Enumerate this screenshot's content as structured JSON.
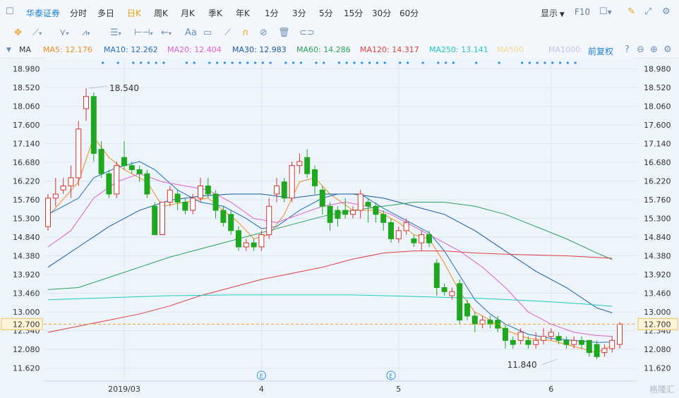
{
  "toolbar": {
    "brand": "华泰证券",
    "periods": [
      "分时",
      "多日",
      "日K",
      "周K",
      "月K",
      "季K",
      "年K",
      "1分",
      "3分",
      "5分",
      "15分",
      "30分",
      "60分"
    ],
    "active_period": "日K",
    "display_label": "显示",
    "f10_label": "F10"
  },
  "drawtools": {
    "text_tool": "Aa"
  },
  "indicator": {
    "name": "MA",
    "adjust_label": "前复权",
    "items": [
      {
        "label": "MA5: 12.176",
        "color": "#f08c1a"
      },
      {
        "label": "MA10: 12.262",
        "color": "#1f6fb8"
      },
      {
        "label": "MA20: 12.404",
        "color": "#e060c8"
      },
      {
        "label": "MA30: 12.983",
        "color": "#1a5aa0"
      },
      {
        "label": "MA60: 14.286",
        "color": "#2aa15a"
      },
      {
        "label": "MA120: 14.317",
        "color": "#e04040"
      },
      {
        "label": "MA250: 13.141",
        "color": "#20c8c0"
      },
      {
        "label": "MA500",
        "color": "#f0d890"
      },
      {
        "label": "MA1000:",
        "color": "#c8c0e8"
      }
    ]
  },
  "watermark": "格隆汇",
  "chart_data": {
    "type": "candlestick",
    "y_ticks": [
      "18.980",
      "18.520",
      "18.060",
      "17.600",
      "17.140",
      "16.680",
      "16.220",
      "15.760",
      "15.300",
      "14.840",
      "14.380",
      "13.920",
      "13.460",
      "13.000",
      "12.540",
      "12.080",
      "11.620"
    ],
    "ylim": [
      11.3,
      19.25
    ],
    "x_labels": [
      {
        "label": "2019/03",
        "index": 10
      },
      {
        "label": "4",
        "index": 28
      },
      {
        "label": "5",
        "index": 46
      },
      {
        "label": "6",
        "index": 66
      }
    ],
    "current_price": "12.700",
    "current_price_value": 12.7,
    "max_label": "18.540",
    "max_index": 5,
    "min_label": "11.840",
    "min_index": 67,
    "event_markers": [
      28,
      45
    ],
    "candles": [
      {
        "o": 15.1,
        "c": 15.8,
        "h": 15.9,
        "l": 15.0
      },
      {
        "o": 15.8,
        "c": 15.9,
        "h": 16.3,
        "l": 15.6
      },
      {
        "o": 16.0,
        "c": 16.1,
        "h": 16.3,
        "l": 15.9
      },
      {
        "o": 16.1,
        "c": 16.3,
        "h": 16.6,
        "l": 15.8
      },
      {
        "o": 16.3,
        "c": 17.5,
        "h": 17.7,
        "l": 16.1
      },
      {
        "o": 18.0,
        "c": 18.3,
        "h": 18.5,
        "l": 17.7
      },
      {
        "o": 18.3,
        "c": 16.9,
        "h": 18.4,
        "l": 16.7
      },
      {
        "o": 17.0,
        "c": 16.4,
        "h": 17.2,
        "l": 16.3
      },
      {
        "o": 16.4,
        "c": 15.9,
        "h": 16.5,
        "l": 15.8
      },
      {
        "o": 15.9,
        "c": 16.6,
        "h": 16.7,
        "l": 15.8
      },
      {
        "o": 16.8,
        "c": 16.6,
        "h": 17.2,
        "l": 16.5
      },
      {
        "o": 16.6,
        "c": 16.5,
        "h": 16.7,
        "l": 16.4
      },
      {
        "o": 16.5,
        "c": 16.4,
        "h": 16.6,
        "l": 16.2
      },
      {
        "o": 16.4,
        "c": 15.9,
        "h": 16.5,
        "l": 15.8
      },
      {
        "o": 15.6,
        "c": 14.9,
        "h": 15.7,
        "l": 14.9
      },
      {
        "o": 14.9,
        "c": 15.7,
        "h": 15.7,
        "l": 14.9
      },
      {
        "o": 15.7,
        "c": 16.0,
        "h": 16.1,
        "l": 15.6
      },
      {
        "o": 15.9,
        "c": 15.7,
        "h": 16.0,
        "l": 15.5
      },
      {
        "o": 15.7,
        "c": 15.5,
        "h": 15.8,
        "l": 15.4
      },
      {
        "o": 15.5,
        "c": 15.8,
        "h": 15.9,
        "l": 15.4
      },
      {
        "o": 15.8,
        "c": 16.1,
        "h": 16.3,
        "l": 15.7
      },
      {
        "o": 16.1,
        "c": 15.9,
        "h": 16.3,
        "l": 15.8
      },
      {
        "o": 15.9,
        "c": 15.5,
        "h": 16.0,
        "l": 15.3
      },
      {
        "o": 15.5,
        "c": 15.2,
        "h": 15.6,
        "l": 15.1
      },
      {
        "o": 15.4,
        "c": 15.0,
        "h": 15.5,
        "l": 14.9
      },
      {
        "o": 15.0,
        "c": 14.6,
        "h": 15.1,
        "l": 14.5
      },
      {
        "o": 14.6,
        "c": 14.7,
        "h": 14.8,
        "l": 14.5
      },
      {
        "o": 14.7,
        "c": 14.6,
        "h": 14.8,
        "l": 14.5
      },
      {
        "o": 14.6,
        "c": 14.9,
        "h": 15.0,
        "l": 14.5
      },
      {
        "o": 14.9,
        "c": 15.6,
        "h": 15.8,
        "l": 14.8
      },
      {
        "o": 15.9,
        "c": 16.1,
        "h": 16.3,
        "l": 15.7
      },
      {
        "o": 16.2,
        "c": 15.8,
        "h": 16.3,
        "l": 15.7
      },
      {
        "o": 15.8,
        "c": 16.6,
        "h": 16.7,
        "l": 15.7
      },
      {
        "o": 16.6,
        "c": 16.7,
        "h": 16.9,
        "l": 16.4
      },
      {
        "o": 16.8,
        "c": 16.4,
        "h": 17.0,
        "l": 16.3
      },
      {
        "o": 16.5,
        "c": 16.1,
        "h": 16.6,
        "l": 15.9
      },
      {
        "o": 16.0,
        "c": 15.6,
        "h": 16.1,
        "l": 15.4
      },
      {
        "o": 15.6,
        "c": 15.2,
        "h": 15.7,
        "l": 15.0
      },
      {
        "o": 15.5,
        "c": 15.3,
        "h": 15.6,
        "l": 15.1
      },
      {
        "o": 15.5,
        "c": 15.4,
        "h": 15.8,
        "l": 15.3
      },
      {
        "o": 15.4,
        "c": 15.5,
        "h": 15.6,
        "l": 15.3
      },
      {
        "o": 15.5,
        "c": 15.9,
        "h": 16.0,
        "l": 15.3
      },
      {
        "o": 15.7,
        "c": 15.6,
        "h": 15.8,
        "l": 15.2
      },
      {
        "o": 15.6,
        "c": 15.4,
        "h": 15.7,
        "l": 15.2
      },
      {
        "o": 15.4,
        "c": 15.2,
        "h": 15.5,
        "l": 15.0
      },
      {
        "o": 15.2,
        "c": 14.8,
        "h": 15.3,
        "l": 14.7
      },
      {
        "o": 14.8,
        "c": 15.0,
        "h": 15.1,
        "l": 14.7
      },
      {
        "o": 15.0,
        "c": 15.2,
        "h": 15.3,
        "l": 14.9
      },
      {
        "o": 14.8,
        "c": 14.7,
        "h": 14.9,
        "l": 14.6
      },
      {
        "o": 14.7,
        "c": 14.9,
        "h": 15.0,
        "l": 14.5
      },
      {
        "o": 14.9,
        "c": 14.7,
        "h": 15.0,
        "l": 14.6
      },
      {
        "o": 14.2,
        "c": 13.6,
        "h": 14.3,
        "l": 13.4
      },
      {
        "o": 13.6,
        "c": 13.5,
        "h": 13.7,
        "l": 13.4
      },
      {
        "o": 13.4,
        "c": 13.5,
        "h": 13.6,
        "l": 13.3
      },
      {
        "o": 13.7,
        "c": 12.8,
        "h": 13.8,
        "l": 12.7
      },
      {
        "o": 13.2,
        "c": 12.9,
        "h": 13.3,
        "l": 12.8
      },
      {
        "o": 12.9,
        "c": 12.7,
        "h": 13.0,
        "l": 12.5
      },
      {
        "o": 12.7,
        "c": 12.8,
        "h": 12.9,
        "l": 12.6
      },
      {
        "o": 12.8,
        "c": 12.7,
        "h": 12.9,
        "l": 12.6
      },
      {
        "o": 12.8,
        "c": 12.6,
        "h": 12.9,
        "l": 12.5
      },
      {
        "o": 12.6,
        "c": 12.3,
        "h": 12.7,
        "l": 12.1
      },
      {
        "o": 12.3,
        "c": 12.2,
        "h": 12.4,
        "l": 12.1
      },
      {
        "o": 12.3,
        "c": 12.5,
        "h": 12.6,
        "l": 12.2
      },
      {
        "o": 12.3,
        "c": 12.2,
        "h": 12.4,
        "l": 12.1
      },
      {
        "o": 12.2,
        "c": 12.3,
        "h": 12.5,
        "l": 12.1
      },
      {
        "o": 12.3,
        "c": 12.4,
        "h": 12.6,
        "l": 12.2
      },
      {
        "o": 12.4,
        "c": 12.5,
        "h": 12.6,
        "l": 12.3
      },
      {
        "o": 12.4,
        "c": 12.3,
        "h": 12.5,
        "l": 12.2
      },
      {
        "o": 12.3,
        "c": 12.2,
        "h": 12.4,
        "l": 12.1
      },
      {
        "o": 12.2,
        "c": 12.3,
        "h": 12.4,
        "l": 12.1
      },
      {
        "o": 12.3,
        "c": 12.2,
        "h": 12.4,
        "l": 12.1
      },
      {
        "o": 12.3,
        "c": 12.0,
        "h": 12.3,
        "l": 11.9
      },
      {
        "o": 12.2,
        "c": 11.9,
        "h": 12.3,
        "l": 11.84
      },
      {
        "o": 12.0,
        "c": 12.1,
        "h": 12.2,
        "l": 11.9
      },
      {
        "o": 12.1,
        "c": 12.3,
        "h": 12.4,
        "l": 12.0
      },
      {
        "o": 12.2,
        "c": 12.7,
        "h": 12.75,
        "l": 12.1
      }
    ],
    "ma_series": [
      {
        "name": "MA5",
        "color": "#f08c1a",
        "points": [
          [
            0,
            15.35
          ],
          [
            4,
            16.2
          ],
          [
            6,
            17.3
          ],
          [
            8,
            16.8
          ],
          [
            10,
            16.5
          ],
          [
            13,
            16.2
          ],
          [
            15,
            15.6
          ],
          [
            18,
            15.7
          ],
          [
            21,
            15.8
          ],
          [
            25,
            15.2
          ],
          [
            27,
            14.8
          ],
          [
            29,
            14.9
          ],
          [
            31,
            15.4
          ],
          [
            33,
            16.2
          ],
          [
            35,
            16.3
          ],
          [
            37,
            15.9
          ],
          [
            40,
            15.5
          ],
          [
            43,
            15.5
          ],
          [
            46,
            15.2
          ],
          [
            48,
            14.9
          ],
          [
            50,
            14.8
          ],
          [
            52,
            14.2
          ],
          [
            54,
            13.5
          ],
          [
            56,
            13.0
          ],
          [
            58,
            12.8
          ],
          [
            60,
            12.55
          ],
          [
            63,
            12.35
          ],
          [
            66,
            12.3
          ],
          [
            68,
            12.2
          ],
          [
            70,
            12.1
          ],
          [
            72,
            12.0
          ],
          [
            74,
            12.18
          ]
        ]
      },
      {
        "name": "MA10",
        "color": "#1f6fb8",
        "points": [
          [
            0,
            15.4
          ],
          [
            4,
            15.8
          ],
          [
            6,
            16.3
          ],
          [
            9,
            16.55
          ],
          [
            12,
            16.7
          ],
          [
            14,
            16.5
          ],
          [
            17,
            16.0
          ],
          [
            20,
            15.7
          ],
          [
            23,
            15.6
          ],
          [
            26,
            15.3
          ],
          [
            28,
            15.05
          ],
          [
            30,
            15.1
          ],
          [
            33,
            15.5
          ],
          [
            36,
            15.8
          ],
          [
            38,
            15.9
          ],
          [
            41,
            15.9
          ],
          [
            44,
            15.55
          ],
          [
            47,
            15.25
          ],
          [
            50,
            14.95
          ],
          [
            52,
            14.5
          ],
          [
            54,
            13.9
          ],
          [
            56,
            13.3
          ],
          [
            58,
            12.95
          ],
          [
            60,
            12.7
          ],
          [
            63,
            12.45
          ],
          [
            66,
            12.35
          ],
          [
            69,
            12.3
          ],
          [
            72,
            12.25
          ],
          [
            74,
            12.26
          ]
        ]
      },
      {
        "name": "MA20",
        "color": "#e060c8",
        "points": [
          [
            0,
            14.6
          ],
          [
            3,
            15.0
          ],
          [
            6,
            15.8
          ],
          [
            9,
            16.2
          ],
          [
            12,
            16.4
          ],
          [
            15,
            16.2
          ],
          [
            18,
            16.1
          ],
          [
            21,
            16.0
          ],
          [
            24,
            15.7
          ],
          [
            27,
            15.3
          ],
          [
            30,
            15.2
          ],
          [
            33,
            15.4
          ],
          [
            36,
            15.6
          ],
          [
            39,
            15.7
          ],
          [
            42,
            15.6
          ],
          [
            45,
            15.4
          ],
          [
            48,
            15.1
          ],
          [
            51,
            14.8
          ],
          [
            54,
            14.5
          ],
          [
            57,
            14.1
          ],
          [
            60,
            13.6
          ],
          [
            63,
            13.0
          ],
          [
            66,
            12.7
          ],
          [
            69,
            12.5
          ],
          [
            72,
            12.42
          ],
          [
            74,
            12.4
          ]
        ]
      },
      {
        "name": "MA30",
        "color": "#1a5aa0",
        "points": [
          [
            0,
            14.1
          ],
          [
            4,
            14.6
          ],
          [
            8,
            15.1
          ],
          [
            12,
            15.5
          ],
          [
            16,
            15.75
          ],
          [
            20,
            15.85
          ],
          [
            24,
            15.9
          ],
          [
            28,
            15.9
          ],
          [
            32,
            15.8
          ],
          [
            36,
            15.9
          ],
          [
            40,
            15.9
          ],
          [
            44,
            15.8
          ],
          [
            48,
            15.6
          ],
          [
            52,
            15.4
          ],
          [
            56,
            15.0
          ],
          [
            60,
            14.5
          ],
          [
            64,
            14.0
          ],
          [
            68,
            13.6
          ],
          [
            72,
            13.1
          ],
          [
            74,
            12.98
          ]
        ]
      },
      {
        "name": "MA60",
        "color": "#2aa15a",
        "points": [
          [
            0,
            13.55
          ],
          [
            4,
            13.6
          ],
          [
            8,
            13.85
          ],
          [
            12,
            14.1
          ],
          [
            16,
            14.35
          ],
          [
            20,
            14.55
          ],
          [
            24,
            14.75
          ],
          [
            28,
            14.95
          ],
          [
            32,
            15.15
          ],
          [
            36,
            15.35
          ],
          [
            40,
            15.5
          ],
          [
            44,
            15.6
          ],
          [
            48,
            15.7
          ],
          [
            52,
            15.7
          ],
          [
            56,
            15.6
          ],
          [
            60,
            15.4
          ],
          [
            64,
            15.1
          ],
          [
            68,
            14.8
          ],
          [
            72,
            14.45
          ],
          [
            74,
            14.29
          ]
        ]
      },
      {
        "name": "MA120",
        "color": "#e04040",
        "points": [
          [
            0,
            12.5
          ],
          [
            4,
            12.65
          ],
          [
            8,
            12.8
          ],
          [
            12,
            12.95
          ],
          [
            16,
            13.15
          ],
          [
            20,
            13.4
          ],
          [
            24,
            13.6
          ],
          [
            28,
            13.8
          ],
          [
            32,
            13.95
          ],
          [
            36,
            14.1
          ],
          [
            40,
            14.3
          ],
          [
            44,
            14.45
          ],
          [
            48,
            14.5
          ],
          [
            52,
            14.5
          ],
          [
            56,
            14.45
          ],
          [
            60,
            14.42
          ],
          [
            64,
            14.4
          ],
          [
            68,
            14.38
          ],
          [
            72,
            14.34
          ],
          [
            74,
            14.32
          ]
        ]
      },
      {
        "name": "MA250",
        "color": "#20c8c0",
        "points": [
          [
            0,
            13.3
          ],
          [
            8,
            13.35
          ],
          [
            16,
            13.4
          ],
          [
            24,
            13.42
          ],
          [
            32,
            13.42
          ],
          [
            40,
            13.42
          ],
          [
            48,
            13.38
          ],
          [
            56,
            13.34
          ],
          [
            64,
            13.27
          ],
          [
            70,
            13.2
          ],
          [
            74,
            13.14
          ]
        ]
      }
    ]
  }
}
